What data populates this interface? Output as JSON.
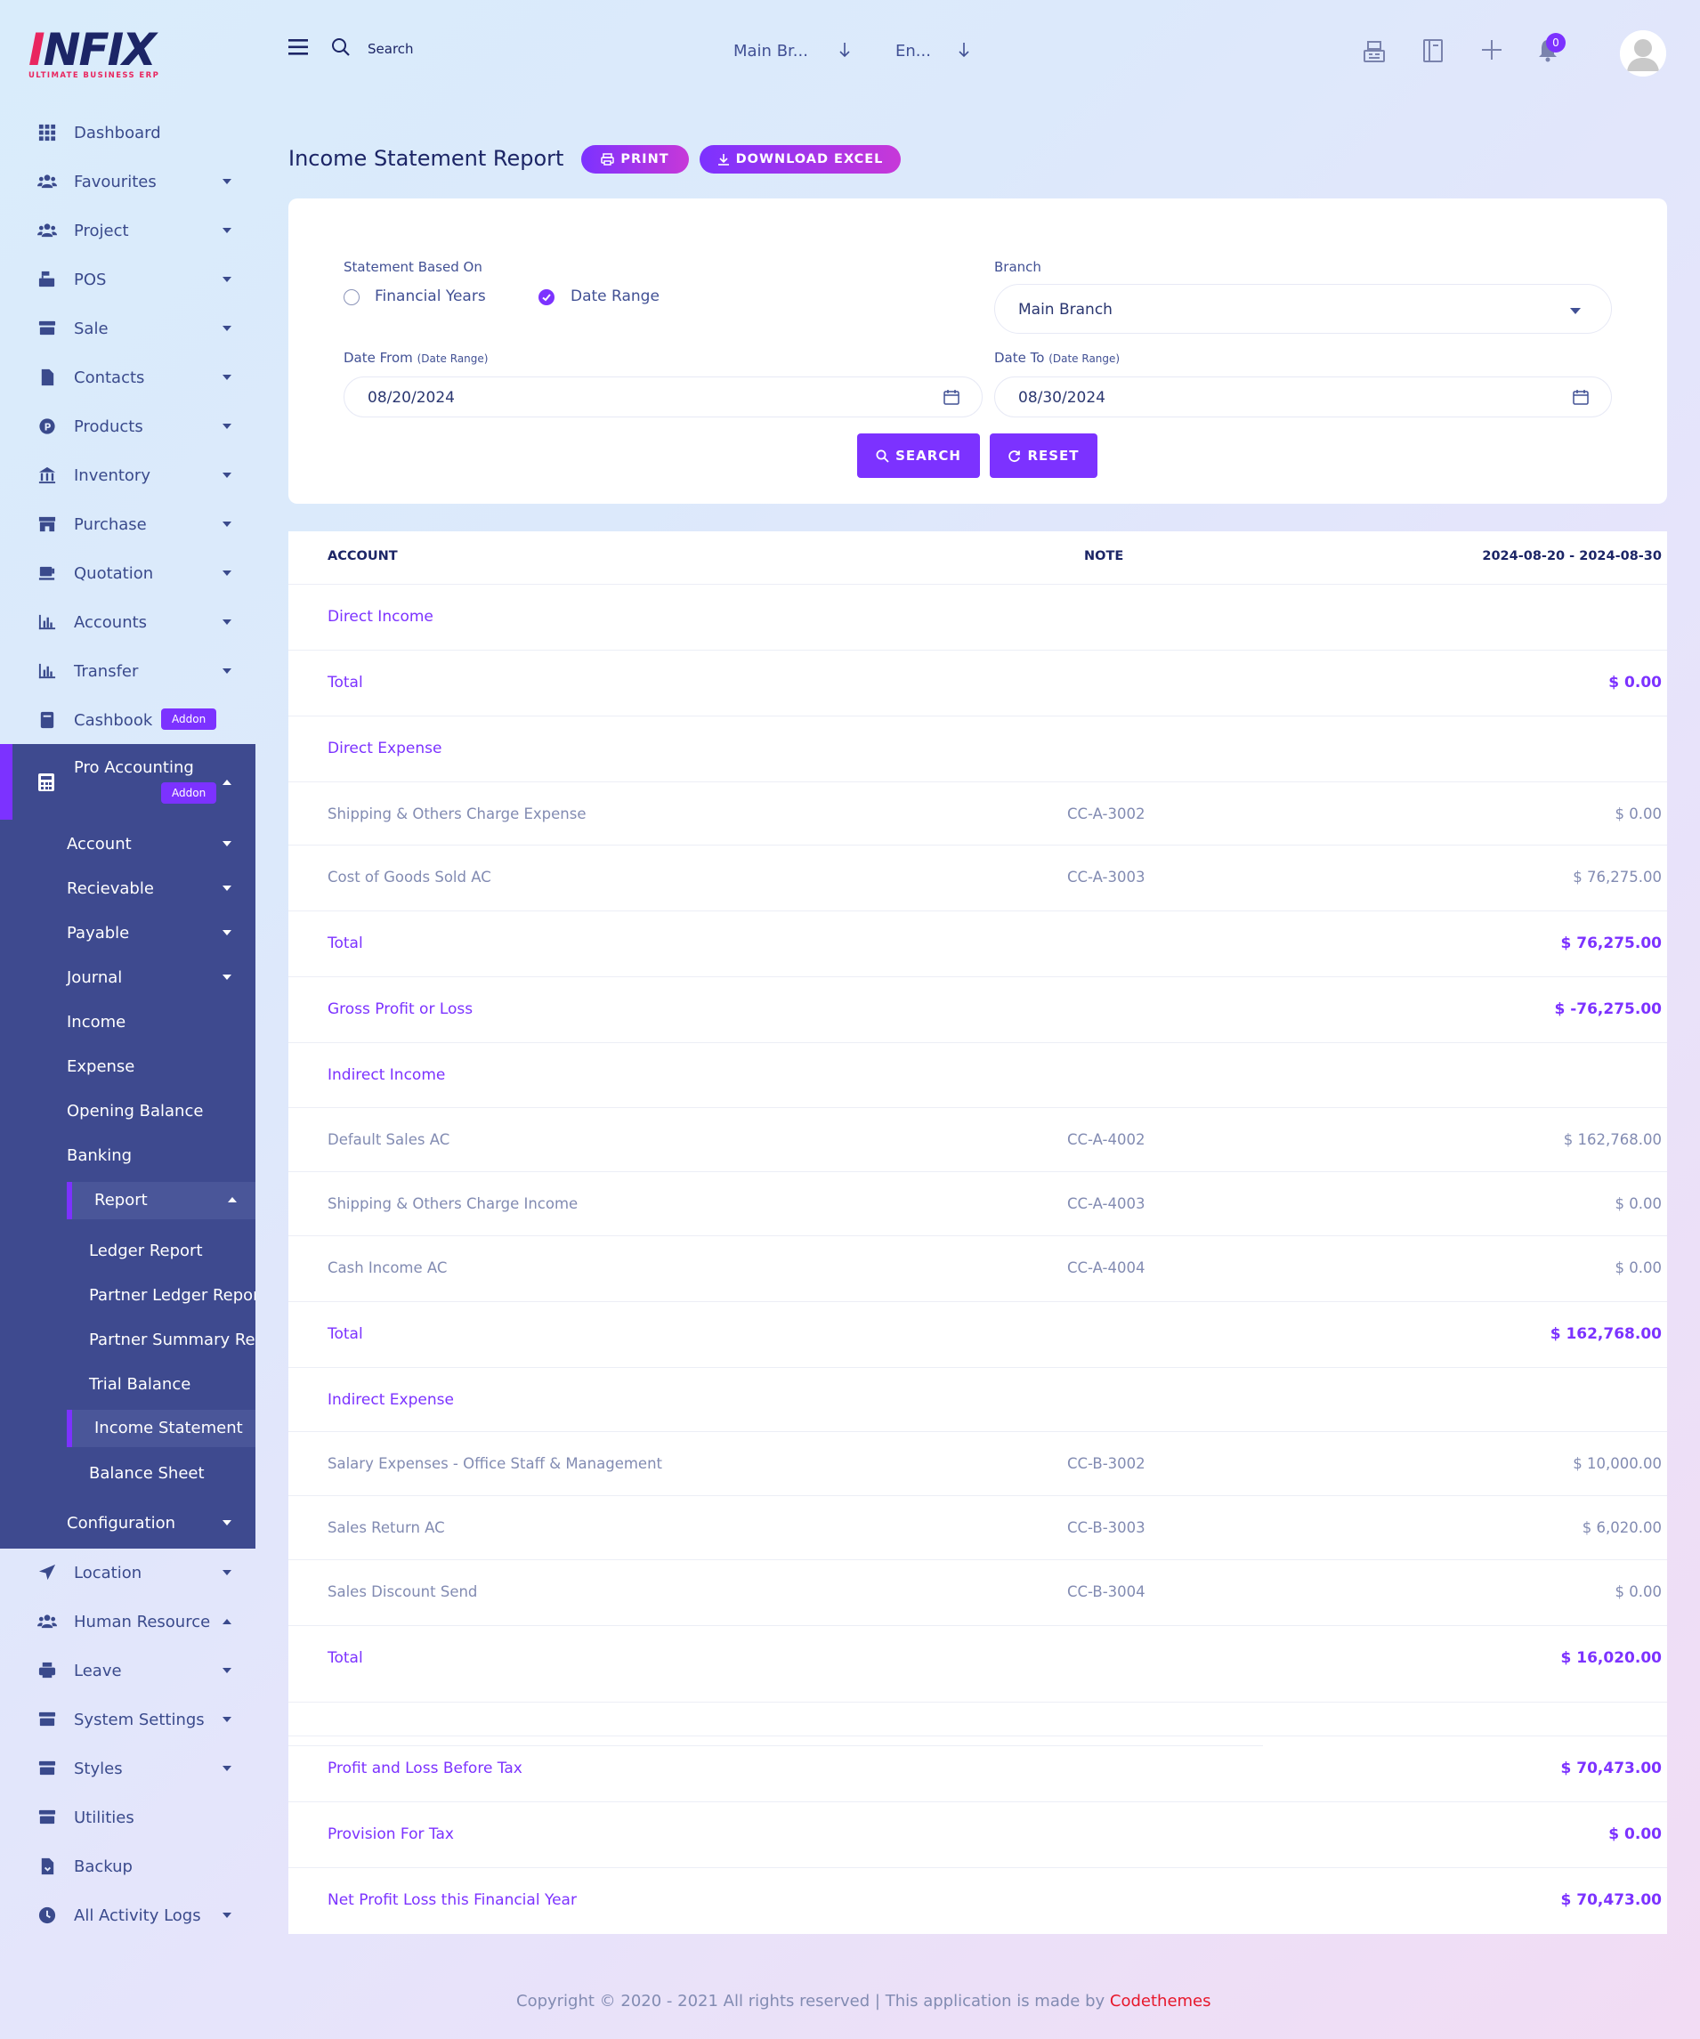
{
  "brand": {
    "logo_text_a": "I",
    "logo_text_b": "NFIX",
    "logo_sub": "ULTIMATE BUSINESS ERP"
  },
  "sidebar": {
    "items": [
      {
        "label": "Dashboard",
        "icon": "grid-icon",
        "caret": false
      },
      {
        "label": "Favourites",
        "icon": "users-icon",
        "caret": true
      },
      {
        "label": "Project",
        "icon": "users-icon",
        "caret": true
      },
      {
        "label": "POS",
        "icon": "cash-register-icon",
        "caret": true
      },
      {
        "label": "Sale",
        "icon": "store-icon",
        "caret": true
      },
      {
        "label": "Contacts",
        "icon": "file-icon",
        "caret": true
      },
      {
        "label": "Products",
        "icon": "product-circle-icon",
        "caret": true
      },
      {
        "label": "Inventory",
        "icon": "bank-icon",
        "caret": true
      },
      {
        "label": "Purchase",
        "icon": "shop-icon",
        "caret": true
      },
      {
        "label": "Quotation",
        "icon": "cup-icon",
        "caret": true
      },
      {
        "label": "Accounts",
        "icon": "bar-chart-icon",
        "caret": true
      },
      {
        "label": "Transfer",
        "icon": "bar-chart-icon",
        "caret": true
      },
      {
        "label": "Cashbook",
        "icon": "book-icon",
        "caret": false,
        "badge": "Addon"
      }
    ],
    "pro_accounting": {
      "label": "Pro Accounting",
      "badge": "Addon",
      "subitems": [
        "Account",
        "Recievable",
        "Payable",
        "Journal",
        "Income",
        "Expense",
        "Opening Balance",
        "Banking"
      ],
      "report": {
        "label": "Report",
        "items": [
          "Ledger Report",
          "Partner Ledger Report",
          "Partner Summary Report",
          "Trial Balance",
          "Income Statement",
          "Balance Sheet"
        ]
      },
      "configuration": "Configuration"
    },
    "bottom_items": [
      {
        "label": "Location",
        "icon": "location-arrow-icon",
        "caret": "down"
      },
      {
        "label": "Human Resource",
        "icon": "users-icon",
        "caret": "up"
      },
      {
        "label": "Leave",
        "icon": "printer-icon",
        "caret": "down"
      },
      {
        "label": "System Settings",
        "icon": "store-icon",
        "caret": "down"
      },
      {
        "label": "Styles",
        "icon": "store-icon",
        "caret": "down"
      },
      {
        "label": "Utilities",
        "icon": "store-icon",
        "caret": "none"
      },
      {
        "label": "Backup",
        "icon": "file-download-icon",
        "caret": "none"
      },
      {
        "label": "All Activity Logs",
        "icon": "clock-icon",
        "caret": "down"
      }
    ]
  },
  "topbar": {
    "search_label": "Search",
    "branch_select": "Main Br...",
    "language_select": "En...",
    "notification_count": "0"
  },
  "page": {
    "title": "Income Statement Report",
    "print_label": "PRINT",
    "excel_label": "DOWNLOAD EXCEL"
  },
  "filters": {
    "statement_label": "Statement Based On",
    "option_financial": "Financial Years",
    "option_range": "Date Range",
    "selected": "Date Range",
    "branch_label": "Branch",
    "branch_value": "Main Branch",
    "date_from_label": "Date From",
    "date_from_hint": "(Date Range)",
    "date_from_value": "08/20/2024",
    "date_to_label": "Date To",
    "date_to_hint": "(Date Range)",
    "date_to_value": "08/30/2024",
    "search_btn": "SEARCH",
    "reset_btn": "RESET"
  },
  "report": {
    "columns": {
      "account": "ACCOUNT",
      "note": "NOTE",
      "period": "2024-08-20 - 2024-08-30"
    },
    "rows": [
      {
        "type": "head",
        "account": "Direct Income",
        "note": "",
        "amount": ""
      },
      {
        "type": "head",
        "account": "Total",
        "note": "",
        "amount": "$ 0.00"
      },
      {
        "type": "head",
        "account": "Direct Expense",
        "note": "",
        "amount": ""
      },
      {
        "type": "plain",
        "account": "Shipping & Others Charge Expense",
        "note": "CC-A-3002",
        "amount": "$ 0.00"
      },
      {
        "type": "plain",
        "account": "Cost of Goods Sold AC",
        "note": "CC-A-3003",
        "amount": "$ 76,275.00"
      },
      {
        "type": "head",
        "account": "Total",
        "note": "",
        "amount": "$ 76,275.00"
      },
      {
        "type": "head",
        "account": "Gross Profit or Loss",
        "note": "",
        "amount": "$ -76,275.00"
      },
      {
        "type": "head",
        "account": "Indirect Income",
        "note": "",
        "amount": ""
      },
      {
        "type": "plain",
        "account": "Default Sales AC",
        "note": "CC-A-4002",
        "amount": "$ 162,768.00"
      },
      {
        "type": "plain",
        "account": "Shipping & Others Charge Income",
        "note": "CC-A-4003",
        "amount": "$ 0.00"
      },
      {
        "type": "plain",
        "account": "Cash Income AC",
        "note": "CC-A-4004",
        "amount": "$ 0.00"
      },
      {
        "type": "head",
        "account": "Total",
        "note": "",
        "amount": "$ 162,768.00"
      },
      {
        "type": "head",
        "account": "Indirect Expense",
        "note": "",
        "amount": ""
      },
      {
        "type": "plain",
        "account": "Salary Expenses - Office Staff & Management",
        "note": "CC-B-3002",
        "amount": "$ 10,000.00"
      },
      {
        "type": "plain",
        "account": "Sales Return AC",
        "note": "CC-B-3003",
        "amount": "$ 6,020.00"
      },
      {
        "type": "plain",
        "account": "Sales Discount Send",
        "note": "CC-B-3004",
        "amount": "$ 0.00"
      },
      {
        "type": "head",
        "account": "Total",
        "note": "",
        "amount": "$ 16,020.00"
      },
      {
        "type": "spacer",
        "account": "",
        "note": "",
        "amount": ""
      },
      {
        "type": "head",
        "account": "Profit and Loss Before Tax",
        "note": "",
        "amount": "$ 70,473.00"
      },
      {
        "type": "head",
        "account": "Provision For Tax",
        "note": "",
        "amount": "$ 0.00"
      },
      {
        "type": "head",
        "account": "Net Profit Loss this Financial Year",
        "note": "",
        "amount": "$ 70,473.00"
      }
    ]
  },
  "footer": {
    "text": "Copyright © 2020 - 2021 All rights reserved | This application is made by ",
    "brand": "Codethemes"
  },
  "colors": {
    "accent": "#7c32ff",
    "navy": "#1c2566",
    "sidebar_active_bg": "#3e4a8f",
    "muted": "#828bb2",
    "footer_brand": "#e7172b"
  }
}
